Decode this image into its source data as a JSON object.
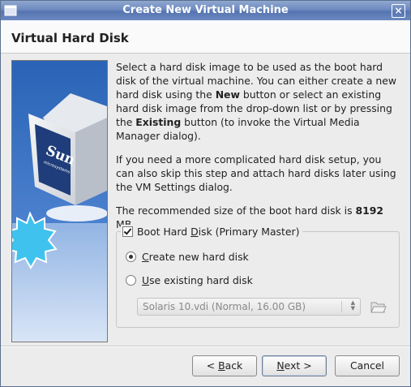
{
  "window": {
    "title": "Create New Virtual Machine",
    "close_glyph": "×"
  },
  "page": {
    "title": "Virtual Hard Disk"
  },
  "sidebar_image": {
    "brand_text": "Sun",
    "brand_sub": "microsystems",
    "icon": "virtualbox-cube-logo"
  },
  "description": {
    "p1_a": "Select a hard disk image to be used as the boot hard disk of the virtual machine. You can either create a new hard disk using the ",
    "p1_new": "New",
    "p1_b": " button or select an existing hard disk image from the drop-down list or by pressing the ",
    "p1_existing": "Existing",
    "p1_c": " button (to invoke the Virtual Media Manager dialog).",
    "p2": "If you need a more complicated hard disk setup, you can also skip this step and attach hard disks later using the VM Settings dialog.",
    "p3_a": "The recommended size of the boot hard disk is ",
    "p3_size": "8192",
    "p3_b": " MB."
  },
  "boot_disk": {
    "checkbox_label_pre": "Boot Hard ",
    "checkbox_label_mn": "D",
    "checkbox_label_post": "isk (Primary Master)",
    "checked": true,
    "create_new": {
      "mn": "C",
      "rest": "reate new hard disk",
      "selected": true
    },
    "use_existing": {
      "mn": "U",
      "rest": "se existing hard disk",
      "selected": false
    },
    "combo_value": "Solaris 10.vdi (Normal, 16.00 GB)",
    "folder_icon": "folder-open-icon"
  },
  "buttons": {
    "back": {
      "pre": "< ",
      "mn": "B",
      "rest": "ack"
    },
    "next": {
      "mn": "N",
      "rest": "ext >"
    },
    "cancel": {
      "label": "Cancel"
    }
  }
}
